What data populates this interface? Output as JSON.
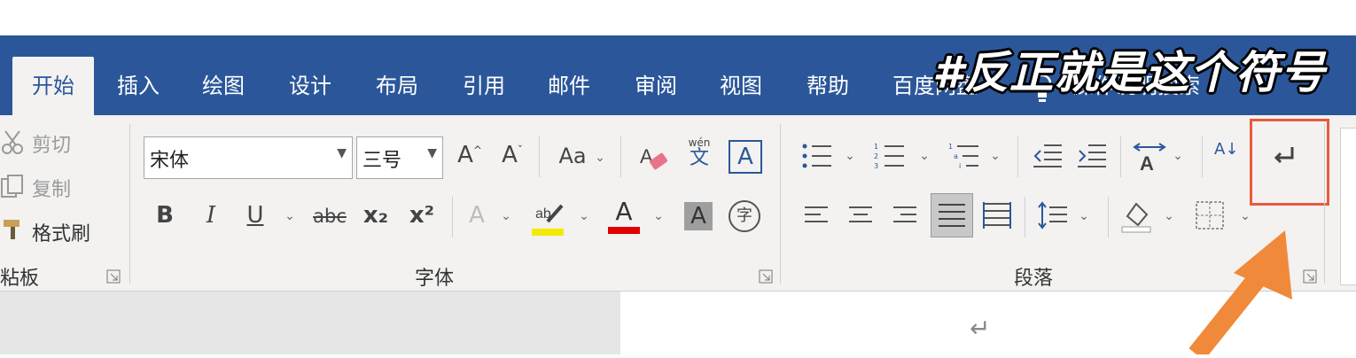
{
  "tabs": [
    "开始",
    "插入",
    "绘图",
    "设计",
    "布局",
    "引用",
    "邮件",
    "审阅",
    "视图",
    "帮助",
    "百度网盘",
    "操作说明搜索"
  ],
  "clipboard": {
    "cut": "剪切",
    "copy": "复制",
    "format_painter": "格式刷",
    "group_label": "粘板"
  },
  "font": {
    "name": "宋体",
    "size": "三号",
    "grow": "A",
    "shrink": "A",
    "case": "Aa",
    "phonetic_top": "wén",
    "phonetic_bottom": "文",
    "bold": "B",
    "italic": "I",
    "underline": "U",
    "strike": "abc",
    "subscript": "x₂",
    "superscript": "x²",
    "enclose": "字",
    "group_label": "字体"
  },
  "paragraph": {
    "group_label": "段落",
    "sort": "A↓"
  },
  "overlay": {
    "caption": "#反正就是这个符号"
  },
  "document": {
    "mark": "↵"
  },
  "colors": {
    "brand": "#2b579a",
    "highlight": "#f2ea00",
    "font_color": "#e00000",
    "callout": "#f08a3a"
  },
  "icons": [
    "cut-icon",
    "copy-icon",
    "format-painter-icon",
    "dialog-launcher-icon",
    "show-marks-icon",
    "bullets-icon",
    "numbering-icon",
    "multilevel-icon"
  ]
}
